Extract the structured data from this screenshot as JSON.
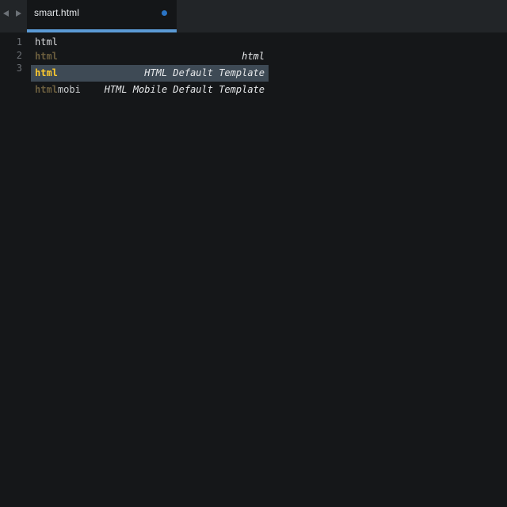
{
  "tabs": [
    {
      "title": "smart.html",
      "dirty": true,
      "active": true
    }
  ],
  "icons": {
    "back": "triangle-left-icon",
    "forward": "triangle-right-icon",
    "dirty": "unsaved-dot-icon"
  },
  "colors": {
    "editor_background": "#151719",
    "tab_accent": "#5b9bd6",
    "dirty_dot": "#2a74c5",
    "match_highlight": "#ffcb2e"
  },
  "editor": {
    "line_numbers": [
      "1",
      "2",
      "3"
    ],
    "lines": [
      "html",
      "",
      ""
    ]
  },
  "autocomplete": {
    "items": [
      {
        "match": "html",
        "rest": "",
        "hint": "html",
        "selected": false
      },
      {
        "match": "html",
        "rest": "",
        "hint": "HTML Default Template",
        "selected": true
      },
      {
        "match": "html",
        "rest": "mobi",
        "hint": "HTML Mobile Default Template",
        "selected": false
      }
    ]
  }
}
